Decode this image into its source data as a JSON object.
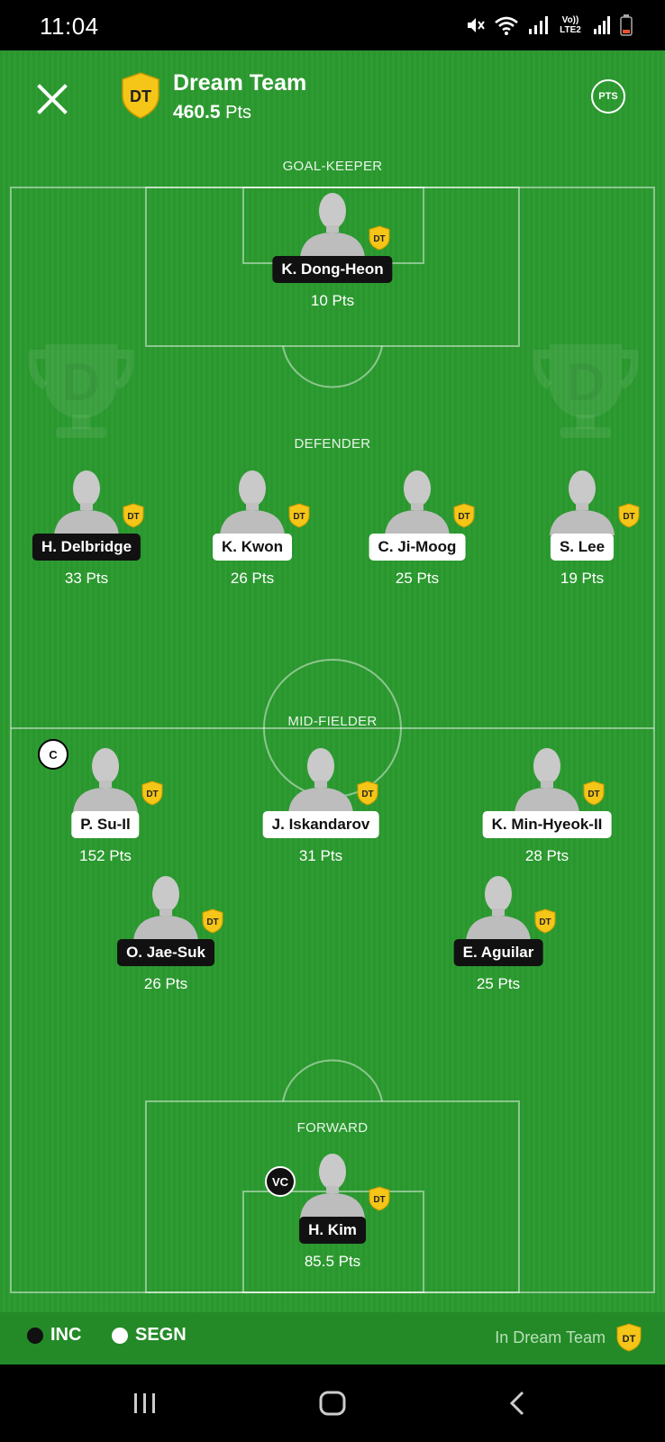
{
  "status_bar": {
    "time": "11:04",
    "icons": [
      "mute-icon",
      "wifi-icon",
      "signal-icon",
      "volte-icon",
      "signal-icon",
      "battery-icon"
    ],
    "volte_label": "Vo)) LTE2"
  },
  "header": {
    "title": "Dream Team",
    "points_value": "460.5",
    "points_unit": "Pts",
    "badge_label": "DT",
    "pts_button_label": "PTS",
    "close_icon": "close-icon"
  },
  "sections": {
    "goalkeeper": "GOAL-KEEPER",
    "defender": "DEFENDER",
    "midfielder": "MID-FIELDER",
    "forward": "FORWARD"
  },
  "players": {
    "goalkeeper": [
      {
        "name": "K. Dong-Heon",
        "points": "10 Pts",
        "team": "INC"
      }
    ],
    "defenders": [
      {
        "name": "H. Delbridge",
        "points": "33 Pts",
        "team": "INC"
      },
      {
        "name": "K. Kwon",
        "points": "26 Pts",
        "team": "SEGN"
      },
      {
        "name": "C. Ji-Moog",
        "points": "25 Pts",
        "team": "SEGN"
      },
      {
        "name": "S. Lee",
        "points": "19 Pts",
        "team": "SEGN"
      }
    ],
    "midfielders": [
      {
        "name": "P. Su-Il",
        "points": "152 Pts",
        "team": "SEGN",
        "role": "C"
      },
      {
        "name": "J. Iskandarov",
        "points": "31 Pts",
        "team": "SEGN"
      },
      {
        "name": "K. Min-Hyeok-II",
        "points": "28 Pts",
        "team": "SEGN"
      },
      {
        "name": "O. Jae-Suk",
        "points": "26 Pts",
        "team": "INC"
      },
      {
        "name": "E. Aguilar",
        "points": "25 Pts",
        "team": "INC"
      }
    ],
    "forwards": [
      {
        "name": "H. Kim",
        "points": "85.5 Pts",
        "team": "INC",
        "role": "VC"
      }
    ]
  },
  "player_badge_label": "DT",
  "legend": {
    "team1": "INC",
    "team2": "SEGN",
    "in_dream_team": "In Dream Team",
    "badge_label": "DT",
    "team1_color": "#111111",
    "team2_color": "#ffffff"
  },
  "colors": {
    "pitch": "#2b9a2f",
    "badge_yellow": "#f5c518",
    "legend_bar": "#238a27"
  },
  "nav_bar": {
    "buttons": [
      "recent-apps-icon",
      "home-icon",
      "back-icon"
    ]
  }
}
